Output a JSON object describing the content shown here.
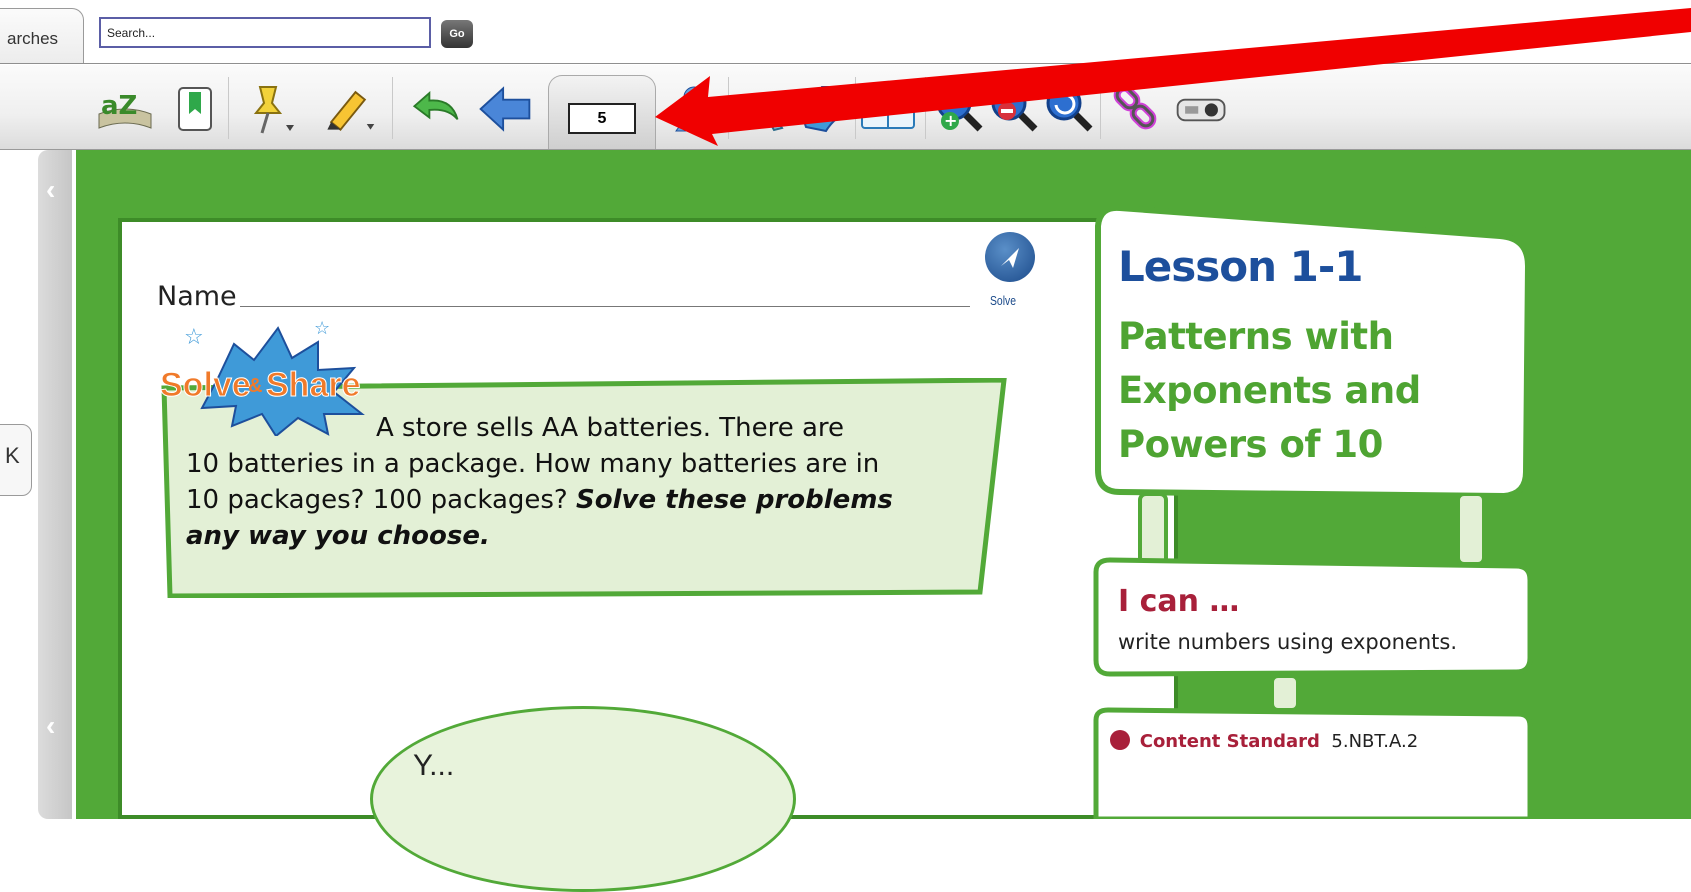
{
  "header": {
    "tab_label": "arches",
    "search_placeholder": "Search...",
    "go_label": "Go"
  },
  "toolbar": {
    "page_number": "5",
    "icons": [
      "glossary-icon",
      "bookmark-icon",
      "pin-icon",
      "highlighter-icon",
      "undo-icon",
      "back-arrow-icon",
      "user-icon",
      "pointer-icon",
      "hand-icon",
      "book-icon",
      "zoom-in-icon",
      "zoom-out-icon",
      "zoom-reset-icon",
      "link-icon",
      "projector-icon"
    ]
  },
  "viewer": {
    "k_tab_label": "K"
  },
  "page": {
    "name_label": "Name",
    "solve_label": "Solve",
    "solve_share": {
      "part1": "Solve",
      "amp": "&",
      "part2": "Share"
    },
    "problem_line1": "A store sells AA batteries. There are",
    "problem_line2": "10 batteries in a package. How many batteries are in",
    "problem_line3": "10 packages? 100 packages?",
    "problem_emph1": "Solve these problems",
    "problem_emph2": "any way you choose.",
    "oval_text": "Y..."
  },
  "lesson": {
    "title_word": "Lesson",
    "title_num": "1-1",
    "subtitle_l1": "Patterns with",
    "subtitle_l2": "Exponents and",
    "subtitle_l3": "Powers of 10",
    "ican_title": "I can …",
    "ican_text": "write numbers using exponents.",
    "std_label": "Content Standard",
    "std_code": "5.NBT.A.2"
  },
  "colors": {
    "green": "#52a938",
    "lesson_blue": "#1d4f9c",
    "accent_red": "#a8203a",
    "arrow_red": "#f00000"
  }
}
